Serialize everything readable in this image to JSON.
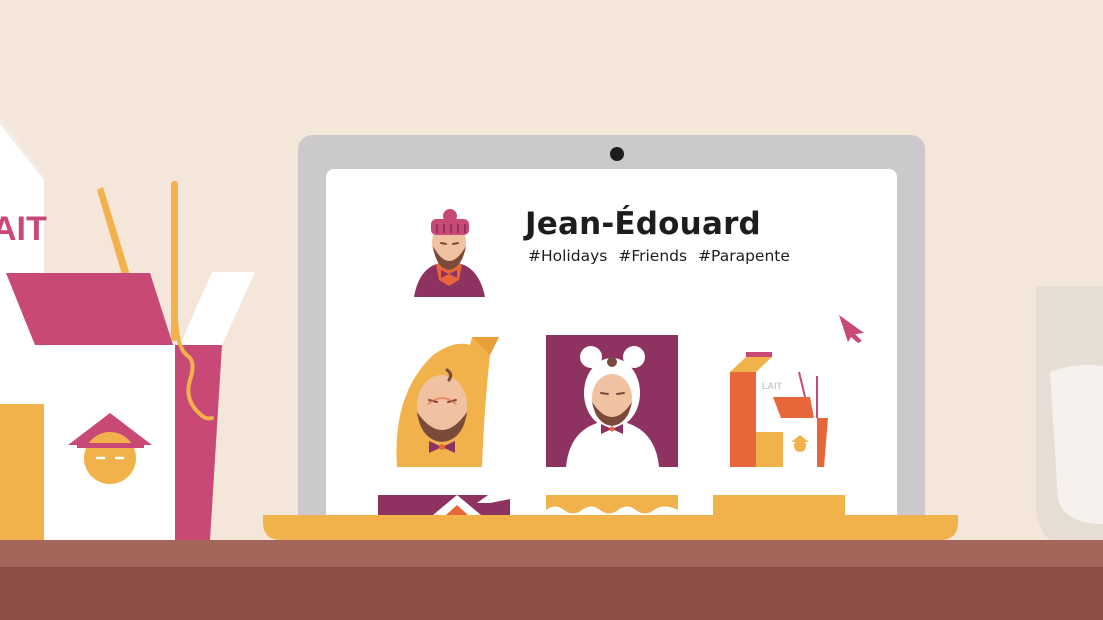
{
  "profile": {
    "name": "Jean-Édouard",
    "hashtags": [
      "#Holidays",
      "#Friends",
      "#Parapente"
    ]
  },
  "milk_carton": {
    "label": "AIT"
  },
  "gallery_milk": {
    "label": "LAIT"
  },
  "colors": {
    "background": "#f5e6da",
    "table_top": "#a4665a",
    "table_front": "#8e5046",
    "laptop_frame": "#cbc9cb",
    "magenta": "#c84876",
    "plum": "#8e3262",
    "mustard": "#f1b24c",
    "orange": "#e8673a"
  },
  "icons": {
    "cursor": "cursor-arrow-icon",
    "webcam": "webcam-icon"
  }
}
